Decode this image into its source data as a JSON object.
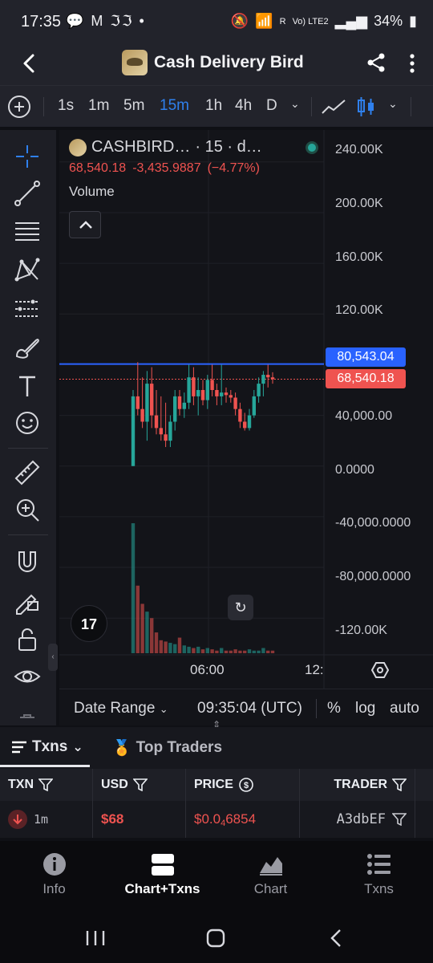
{
  "status_bar": {
    "time": "17:35",
    "notification_icons": "💬 M ℑℑ •",
    "network_label": "R",
    "volte_label": "Vo) LTE2",
    "battery": "34%"
  },
  "app_bar": {
    "title": "Cash Delivery Bird"
  },
  "toolbar": {
    "intervals": [
      "1s",
      "1m",
      "5m",
      "15m",
      "1h",
      "4h",
      "D"
    ],
    "active_interval": "15m"
  },
  "legend": {
    "symbol": "CASHBIRD…",
    "interval_suffix": "· 15 · d…",
    "last_price": "68,540.18",
    "change": "-3,435.9887",
    "change_pct": "(−4.77%)",
    "volume_label": "Volume"
  },
  "y_axis": {
    "ticks": [
      "240.00K",
      "200.00K",
      "160.00K",
      "120.00K",
      "40,000.00",
      "0.0000",
      "-40,000.0000",
      "-80,000.0000",
      "-120.00K"
    ],
    "tag_high": "80,543.04",
    "tag_last": "68,540.18"
  },
  "x_axis": {
    "ticks": [
      "06:00",
      "12:"
    ]
  },
  "chart_bottom_bar": {
    "date_range": "Date Range",
    "time": "09:35:04 (UTC)",
    "percent": "%",
    "log": "log",
    "auto": "auto"
  },
  "tv_logo": "17",
  "txn_tabs": {
    "txns": "Txns",
    "top_traders": "Top Traders"
  },
  "table": {
    "headers": [
      "TXN",
      "USD",
      "PRICE",
      "TRADER"
    ],
    "rows": [
      {
        "age": "1m",
        "usd": "$68",
        "price_prefix": "$0.0",
        "price_sub": "4",
        "price_rest": "6854",
        "trader": "A3dbEF"
      }
    ]
  },
  "bottom_nav": {
    "items": [
      "Info",
      "Chart+Txns",
      "Chart",
      "Txns"
    ],
    "active": "Chart+Txns"
  },
  "colors": {
    "up": "#26a69a",
    "down": "#ef5350",
    "accent": "#2f80ed",
    "high_line": "#2962ff"
  },
  "chart_data": {
    "type": "candlestick",
    "title": "",
    "xlabel": "",
    "ylabel": "",
    "ylim": [
      -130000,
      250000
    ],
    "x_ticks": [
      "06:00",
      "12:"
    ],
    "price_lines": {
      "high": 80543.04,
      "last": 68540.18
    },
    "candles": [
      {
        "o": 0,
        "h": 60000,
        "l": 0,
        "c": 55000
      },
      {
        "o": 55000,
        "h": 82000,
        "l": 40000,
        "c": 45000
      },
      {
        "o": 45000,
        "h": 70000,
        "l": 30000,
        "c": 35000
      },
      {
        "o": 35000,
        "h": 75000,
        "l": 20000,
        "c": 65000
      },
      {
        "o": 65000,
        "h": 78000,
        "l": 30000,
        "c": 40000
      },
      {
        "o": 40000,
        "h": 60000,
        "l": 25000,
        "c": 30000
      },
      {
        "o": 30000,
        "h": 55000,
        "l": 20000,
        "c": 25000
      },
      {
        "o": 25000,
        "h": 50000,
        "l": 15000,
        "c": 20000
      },
      {
        "o": 20000,
        "h": 40000,
        "l": 15000,
        "c": 35000
      },
      {
        "o": 35000,
        "h": 60000,
        "l": 28000,
        "c": 55000
      },
      {
        "o": 55000,
        "h": 60000,
        "l": 40000,
        "c": 45000
      },
      {
        "o": 45000,
        "h": 58000,
        "l": 38000,
        "c": 50000
      },
      {
        "o": 50000,
        "h": 80000,
        "l": 45000,
        "c": 70000
      },
      {
        "o": 70000,
        "h": 78000,
        "l": 48000,
        "c": 55000
      },
      {
        "o": 55000,
        "h": 70000,
        "l": 40000,
        "c": 60000
      },
      {
        "o": 60000,
        "h": 68000,
        "l": 48000,
        "c": 52000
      },
      {
        "o": 52000,
        "h": 72000,
        "l": 45000,
        "c": 68000
      },
      {
        "o": 68000,
        "h": 80000,
        "l": 55000,
        "c": 60000
      },
      {
        "o": 60000,
        "h": 65000,
        "l": 48000,
        "c": 55000
      },
      {
        "o": 55000,
        "h": 80000,
        "l": 48000,
        "c": 58000
      },
      {
        "o": 58000,
        "h": 62000,
        "l": 50000,
        "c": 56000
      },
      {
        "o": 56000,
        "h": 60000,
        "l": 50000,
        "c": 54000
      },
      {
        "o": 54000,
        "h": 58000,
        "l": 40000,
        "c": 45000
      },
      {
        "o": 45000,
        "h": 50000,
        "l": 30000,
        "c": 35000
      },
      {
        "o": 35000,
        "h": 42000,
        "l": 28000,
        "c": 30000
      },
      {
        "o": 30000,
        "h": 45000,
        "l": 28000,
        "c": 40000
      },
      {
        "o": 40000,
        "h": 60000,
        "l": 38000,
        "c": 55000
      },
      {
        "o": 55000,
        "h": 70000,
        "l": 50000,
        "c": 65000
      },
      {
        "o": 65000,
        "h": 75000,
        "l": 55000,
        "c": 72000
      },
      {
        "o": 72000,
        "h": 80000,
        "l": 62000,
        "c": 70000
      },
      {
        "o": 70000,
        "h": 74000,
        "l": 65000,
        "c": 68540
      }
    ],
    "volume_relative": [
      1.0,
      0.52,
      0.38,
      0.32,
      0.27,
      0.16,
      0.1,
      0.09,
      0.08,
      0.07,
      0.12,
      0.06,
      0.05,
      0.04,
      0.05,
      0.03,
      0.04,
      0.03,
      0.02,
      0.04,
      0.02,
      0.02,
      0.03,
      0.02,
      0.02,
      0.03,
      0.02,
      0.02,
      0.04,
      0.02,
      0.02
    ]
  }
}
